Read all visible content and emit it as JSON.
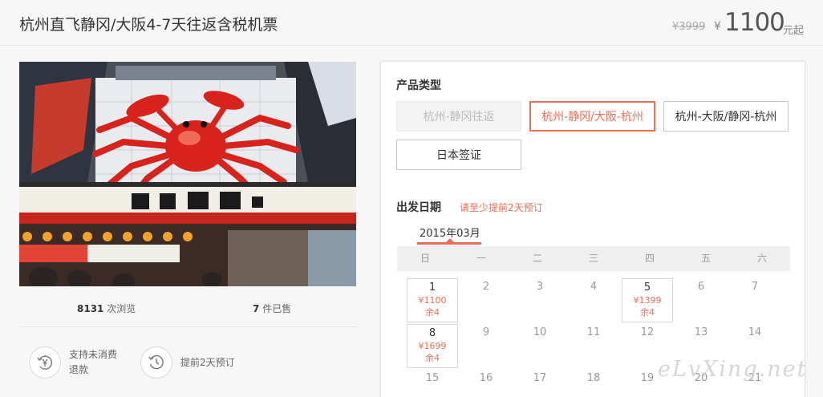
{
  "header": {
    "title": "杭州直飞静冈/大阪4-7天往返含税机票",
    "original_price": "¥3999",
    "currency": "¥",
    "price": "1100",
    "price_unit": "元起"
  },
  "stats": {
    "views_count": "8131",
    "views_label": "次浏览",
    "sold_count": "7",
    "sold_label": "件已售"
  },
  "features": [
    {
      "icon": "yen-refund-icon",
      "text": "支持未消费退款"
    },
    {
      "icon": "clock-history-icon",
      "text": "提前2天预订"
    }
  ],
  "product": {
    "section_title": "产品类型",
    "options": [
      {
        "label": "杭州-静冈往返",
        "state": "disabled"
      },
      {
        "label": "杭州-静冈/大阪-杭州",
        "state": "selected"
      },
      {
        "label": "杭州-大阪/静冈-杭州",
        "state": "normal"
      },
      {
        "label": "日本签证",
        "state": "normal"
      }
    ]
  },
  "departure": {
    "section_title": "出发日期",
    "note": "请至少提前2天预订",
    "month_tab": "2015年03月",
    "weekdays": [
      "日",
      "一",
      "二",
      "三",
      "四",
      "五",
      "六"
    ],
    "days": [
      {
        "day": "1",
        "price": "¥1100",
        "stock": "余4"
      },
      {
        "day": "2"
      },
      {
        "day": "3"
      },
      {
        "day": "4"
      },
      {
        "day": "5",
        "price": "¥1399",
        "stock": "余4"
      },
      {
        "day": "6"
      },
      {
        "day": "7"
      },
      {
        "day": "8",
        "price": "¥1699",
        "stock": "余4"
      },
      {
        "day": "9"
      },
      {
        "day": "10"
      },
      {
        "day": "11"
      },
      {
        "day": "12"
      },
      {
        "day": "13"
      },
      {
        "day": "14"
      },
      {
        "day": "15"
      },
      {
        "day": "16"
      },
      {
        "day": "17"
      },
      {
        "day": "18"
      },
      {
        "day": "19"
      },
      {
        "day": "20"
      },
      {
        "day": "21"
      }
    ]
  },
  "colors": {
    "accent": "#ef6d55",
    "crab": "#d8231c"
  },
  "watermark": "eLvXing.net"
}
